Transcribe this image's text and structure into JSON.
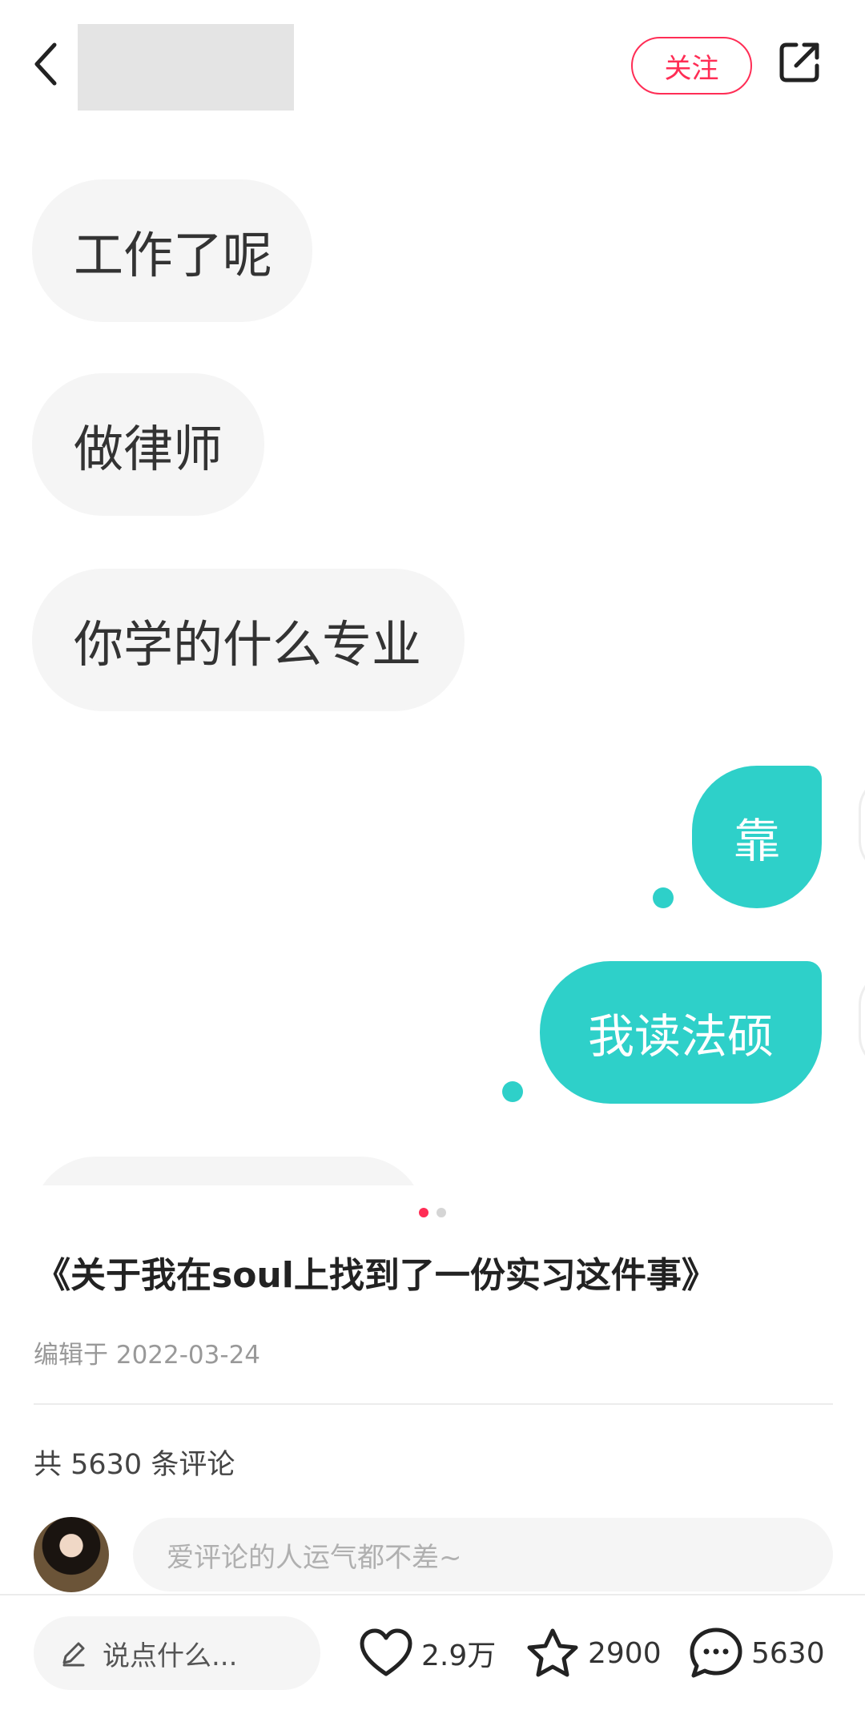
{
  "header": {
    "author_name": "",
    "follow_label": "关注"
  },
  "chat": {
    "messages_left": [
      "工作了呢",
      "做律师",
      "你学的什么专业"
    ],
    "messages_right": [
      "靠",
      "我读法硕"
    ]
  },
  "colors": {
    "accent": "#ff2d55",
    "bubble_right": "#2ed0c9",
    "bubble_left": "#f5f5f5"
  },
  "carousel": {
    "current": 1,
    "total": 2
  },
  "post": {
    "title": "《关于我在soul上找到了一份实习这件事》",
    "date": "编辑于 2022-03-24"
  },
  "comments": {
    "count_text": "共 5630 条评论",
    "input_placeholder": "爱评论的人运气都不差~"
  },
  "bottom_bar": {
    "say_placeholder": "说点什么...",
    "like_count": "2.9万",
    "collect_count": "2900",
    "comment_count": "5630"
  },
  "icons": {
    "back": "chevron-left-icon",
    "share": "share-icon",
    "edit": "pencil-icon",
    "like": "heart-icon",
    "collect": "star-icon",
    "comment": "chat-bubble-icon"
  }
}
